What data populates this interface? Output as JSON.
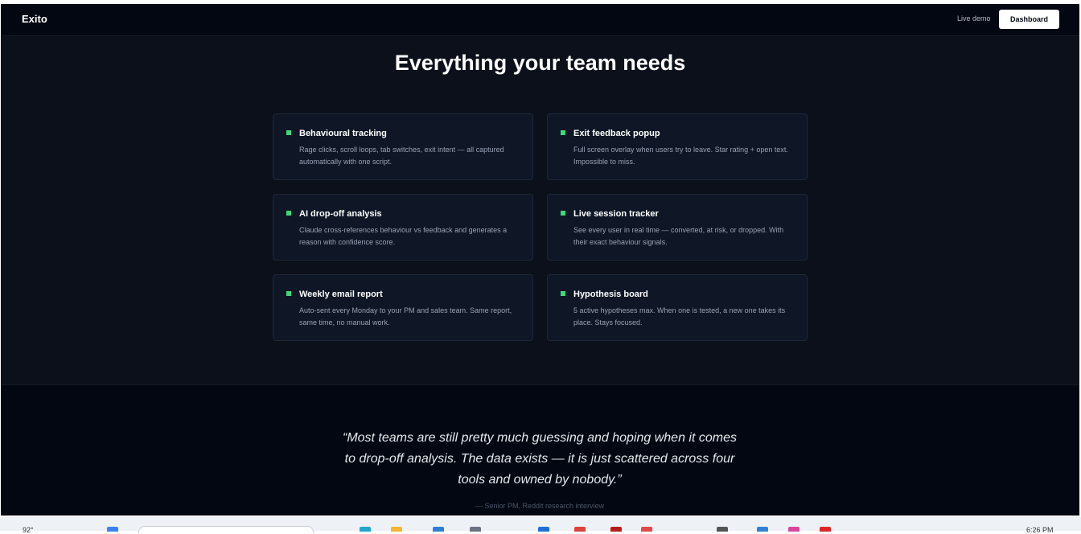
{
  "nav": {
    "logo": "Exito",
    "live_demo": "Live demo",
    "dashboard": "Dashboard"
  },
  "features": {
    "title": "Everything your team needs",
    "accent_color": "#3ed97a",
    "items": [
      {
        "title": "Behavioural tracking",
        "desc": "Rage clicks, scroll loops, tab switches, exit intent — all captured automatically with one script."
      },
      {
        "title": "Exit feedback popup",
        "desc": "Full screen overlay when users try to leave. Star rating + open text. Impossible to miss."
      },
      {
        "title": "AI drop-off analysis",
        "desc": "Claude cross-references behaviour vs feedback and generates a reason with confidence score."
      },
      {
        "title": "Live session tracker",
        "desc": "See every user in real time — converted, at risk, or dropped. With their exact behaviour signals."
      },
      {
        "title": "Weekly email report",
        "desc": "Auto-sent every Monday to your PM and sales team. Same report, same time, no manual work."
      },
      {
        "title": "Hypothesis board",
        "desc": "5 active hypotheses max. When one is tested, a new one takes its place. Stays focused."
      }
    ]
  },
  "quote": {
    "text": "“Most teams are still pretty much guessing and hoping when it comes to drop-off analysis. The data exists — it is just scattered across four tools and owned by nobody.”",
    "attribution": "— Senior PM, Reddit research interview"
  },
  "taskbar": {
    "temperature": "92°",
    "time": "6:26 PM"
  }
}
